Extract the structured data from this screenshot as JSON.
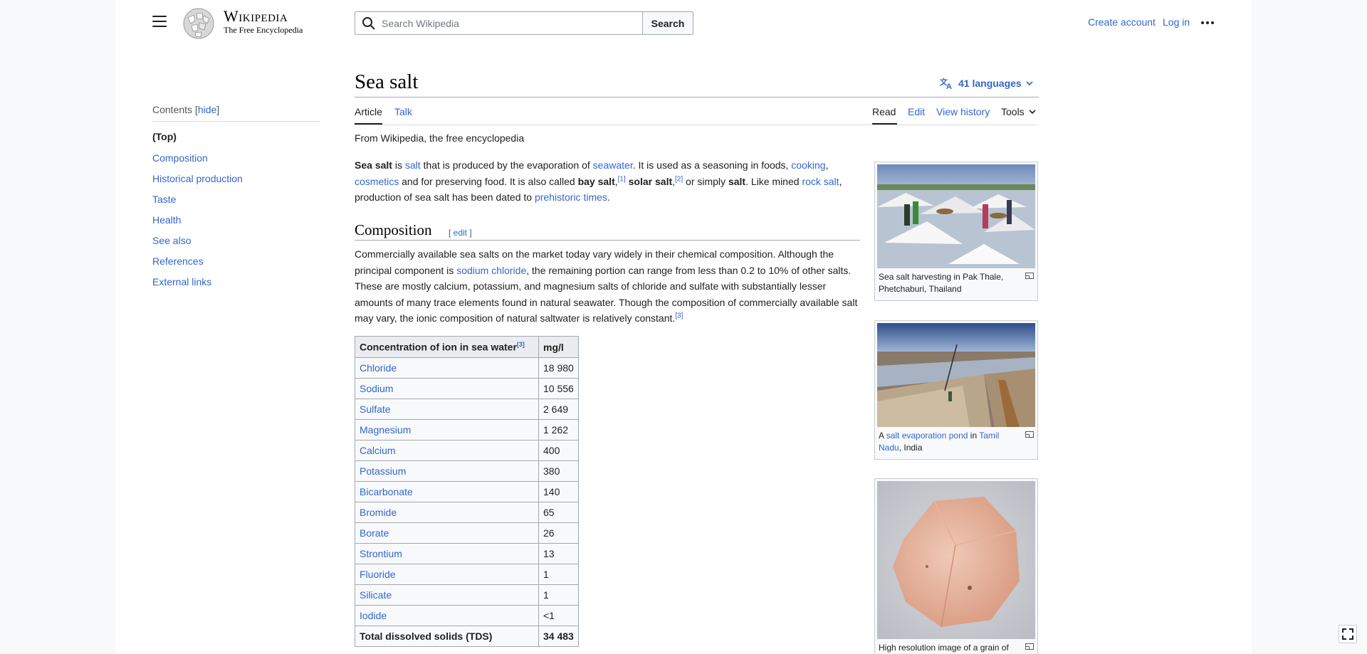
{
  "header": {
    "wordmark": "Wikipedia",
    "tagline": "The Free Encyclopedia",
    "search_placeholder": "Search Wikipedia",
    "search_button": "Search",
    "create_account": "Create account",
    "log_in": "Log in"
  },
  "toc": {
    "heading": "Contents",
    "hide": "hide",
    "items": [
      "(Top)",
      "Composition",
      "Historical production",
      "Taste",
      "Health",
      "See also",
      "References",
      "External links"
    ]
  },
  "article": {
    "title": "Sea salt",
    "languages": "41 languages",
    "tabs": [
      "Article",
      "Talk"
    ],
    "actions": [
      "Read",
      "Edit",
      "View history",
      "Tools"
    ],
    "from": "From Wikipedia, the free encyclopedia",
    "lead": {
      "t1": "Sea salt",
      "t2": " is ",
      "l_salt": "salt",
      "t3": " that is produced by the evaporation of ",
      "l_seawater": "seawater",
      "t4": ". It is used as a seasoning in foods, ",
      "l_cooking": "cooking",
      "t5": ", ",
      "l_cosmetics": "cosmetics",
      "t6": " and for preserving food. It is also called ",
      "b_bay": "bay salt",
      "r1": "[1]",
      "b_solar": "solar salt",
      "r2": "[2]",
      "t7": " or simply ",
      "b_salt": "salt",
      "t8": ". Like mined ",
      "l_rock": "rock salt",
      "t9": ", production of sea salt has been dated to ",
      "l_prehist": "prehistoric times",
      "t10": "."
    },
    "composition": {
      "heading": "Composition",
      "edit": "edit",
      "p1": "Commercially available sea salts on the market today vary widely in their chemical composition. Although the principal component is ",
      "l_nacl": "sodium chloride",
      "p2": ", the remaining portion can range from less than 0.2 to 10% of other salts. These are mostly calcium, potassium, and magnesium salts of chloride and sulfate with substantially lesser amounts of many trace elements found in natural seawater. Though the composition of commercially available salt may vary, the ionic composition of natural saltwater is relatively constant.",
      "r3": "[3]"
    },
    "ion_table": {
      "col1": "Concentration of ion in sea water",
      "col1_ref": "[3]",
      "col2": "mg/l",
      "rows": [
        {
          "ion": "Chloride",
          "value": "18 980"
        },
        {
          "ion": "Sodium",
          "value": "10 556"
        },
        {
          "ion": "Sulfate",
          "value": "2 649"
        },
        {
          "ion": "Magnesium",
          "value": "1 262"
        },
        {
          "ion": "Calcium",
          "value": "400"
        },
        {
          "ion": "Potassium",
          "value": "380"
        },
        {
          "ion": "Bicarbonate",
          "value": "140"
        },
        {
          "ion": "Bromide",
          "value": "65"
        },
        {
          "ion": "Borate",
          "value": "26"
        },
        {
          "ion": "Strontium",
          "value": "13"
        },
        {
          "ion": "Fluoride",
          "value": "1"
        },
        {
          "ion": "Silicate",
          "value": "1"
        },
        {
          "ion": "Iodide",
          "value": "<1"
        }
      ],
      "total_label": "Total dissolved solids (TDS)",
      "total_value": "34 483"
    },
    "thumbs": {
      "t1_caption": "Sea salt harvesting in Pak Thale, Phetchaburi, Thailand",
      "t2_a": "A ",
      "t2_l1": "salt evaporation pond",
      "t2_b": " in ",
      "t2_l2": "Tamil Nadu",
      "t2_c": ", India",
      "t3_caption": "High resolution image of a grain of"
    }
  },
  "colors": {
    "link": "#3366cc",
    "text": "#202122",
    "border": "#a2a9b1"
  }
}
